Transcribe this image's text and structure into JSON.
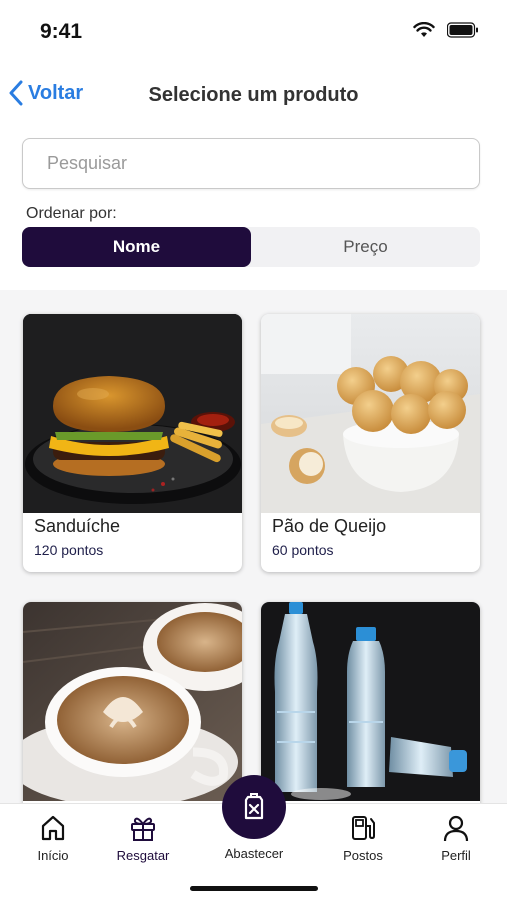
{
  "status_bar": {
    "time": "9:41"
  },
  "nav": {
    "back_label": "Voltar",
    "title": "Selecione um produto"
  },
  "search": {
    "placeholder": "Pesquisar",
    "value": ""
  },
  "sort": {
    "label": "Ordenar por:",
    "options": [
      "Nome",
      "Preço"
    ],
    "selected": "Nome"
  },
  "products": [
    {
      "name": "Sanduíche",
      "points": "120 pontos",
      "image": "burger-photo"
    },
    {
      "name": "Pão de Queijo",
      "points": "60 pontos",
      "image": "cheese-bread-photo"
    },
    {
      "name": "",
      "points": "",
      "image": "coffee-photo"
    },
    {
      "name": "",
      "points": "",
      "image": "water-bottles-photo"
    }
  ],
  "tabbar": {
    "items": [
      {
        "label": "Início",
        "icon": "home-icon"
      },
      {
        "label": "Resgatar",
        "icon": "gift-icon"
      },
      {
        "label": "Abastecer",
        "icon": "fuel-can-icon"
      },
      {
        "label": "Postos",
        "icon": "gas-station-icon"
      },
      {
        "label": "Perfil",
        "icon": "user-icon"
      }
    ]
  },
  "colors": {
    "primary": "#1f0c3c",
    "link": "#2a7de1",
    "accent_text": "#1f1f4a"
  }
}
